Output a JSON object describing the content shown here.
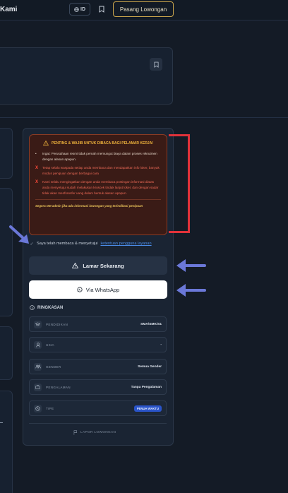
{
  "header": {
    "brand": "Kami",
    "lang_label": "ID",
    "post_button": "Pasang Lowongan"
  },
  "notice": {
    "title": "PENTING & WAJIB UNTUK DIBACA BAGI PELAMAR KERJA!",
    "items": [
      {
        "type": "info",
        "text": "Ingat: Perusahaan resmi tidak pernah memungut biaya dalam proses rekrutmen dengan alasan apapun."
      },
      {
        "type": "warn",
        "text": "Tetap selalu waspada setiap anda membaca dan mendapatkan info loker, banyak modus penipuan dengan berbagai cara"
      },
      {
        "type": "warn",
        "text": "Kami selalu mengingatkan dengan anda membaca postingan informasi diatas anda menyetujui sudah melakukan kroscek tindak lanjut loker, dan dengan sadar tidak akan menfransfer uang dalam bentuk alasan apapun."
      }
    ],
    "footer": "Segera DM admin jika ada informasi lowongan yang terindikasi penipuan"
  },
  "agreement": {
    "text": "Saya telah membaca & menyetujui",
    "link": "ketentuan pengguna layanan"
  },
  "actions": {
    "apply": "Lamar Sekarang",
    "whatsapp": "Via WhatsApp"
  },
  "summary": {
    "title": "RINGKASAN",
    "rows": [
      {
        "label": "PENDIDIKAN",
        "value": "SMA/SMK/S1",
        "icon": "graduation-cap-icon"
      },
      {
        "label": "USIA",
        "value": "-",
        "icon": "user-icon"
      },
      {
        "label": "GENDER",
        "value": "Semua Gender",
        "icon": "users-icon"
      },
      {
        "label": "PENGALAMAN",
        "value": "Tanpa Pengalaman",
        "icon": "briefcase-icon"
      },
      {
        "label": "TIPE",
        "value": "PENUH WAKTU",
        "icon": "clock-icon"
      }
    ]
  },
  "report": "LAPOR LOWONGAN",
  "colors": {
    "background": "#141b26",
    "card": "#1a2433",
    "warning_accent": "#f0b43c",
    "danger": "#ee6a57",
    "link": "#4b8ce8",
    "badge": "#2a54c9",
    "annotation_red": "#e0323a",
    "annotation_arrow": "#6b78d8"
  }
}
